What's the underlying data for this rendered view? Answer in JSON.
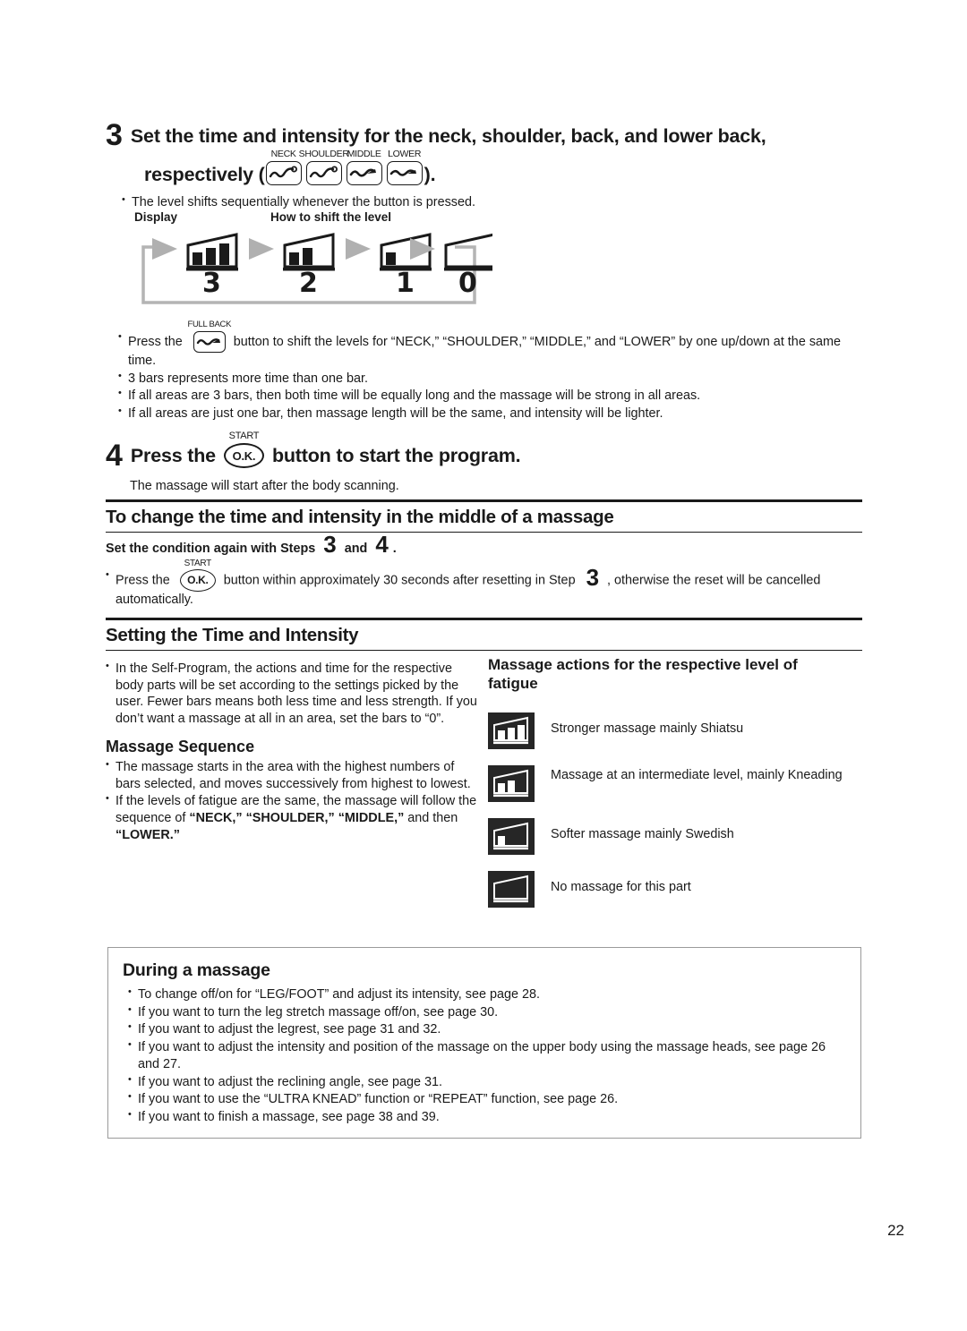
{
  "page": {
    "number": "22"
  },
  "step3": {
    "number": "3",
    "title_line1": "Set the time and intensity for the neck, shoulder, back, and lower back,",
    "title_line2_pre": "respectively (",
    "title_line2_post": ").",
    "buttons": [
      {
        "caption": "NECK",
        "icon": "massage-wave-icon"
      },
      {
        "caption": "SHOULDER",
        "icon": "massage-wave-icon"
      },
      {
        "caption": "MIDDLE",
        "icon": "massage-wave-icon"
      },
      {
        "caption": "LOWER",
        "icon": "massage-wave-icon"
      }
    ],
    "note": "The level shifts sequentially whenever the button is pressed."
  },
  "diagram": {
    "label_display": "Display",
    "label_howto": "How to shift the level",
    "levels": [
      {
        "value": "3",
        "bars": 3,
        "icon": "level-3-icon"
      },
      {
        "value": "2",
        "bars": 2,
        "icon": "level-2-icon"
      },
      {
        "value": "1",
        "bars": 1,
        "icon": "level-1-icon"
      },
      {
        "value": "0",
        "bars": 0,
        "icon": "level-0-icon"
      }
    ]
  },
  "fullback": {
    "caption": "FULL BACK",
    "bullets": [
      {
        "pre": "Press the",
        "post": "button to shift the levels for “NECK,” “SHOULDER,” “MIDDLE,” and “LOWER” by one up/down at the same time."
      }
    ],
    "plain_bullets": [
      "3 bars represents more time than one bar.",
      "If all areas are 3 bars, then both time will be equally long and the massage will be strong in all areas.",
      "If all areas are just one bar, then massage length will be the same, and intensity will be lighter."
    ]
  },
  "step4": {
    "number": "4",
    "title_pre": "Press the",
    "title_post": "button to start the program.",
    "button": {
      "caption": "START",
      "label": "O.K."
    },
    "note": "The massage will start after the body scanning."
  },
  "section_change": {
    "heading": "To change the time and intensity in the middle of a massage",
    "lead_pre": "Set the condition again with Steps",
    "lead_num1": "3",
    "lead_and": "and",
    "lead_num2": "4",
    "lead_end": ".",
    "bullet_pre": "Press the",
    "button": {
      "caption": "START",
      "label": "O.K."
    },
    "bullet_mid": "button within approximately 30 seconds after resetting in Step",
    "bullet_num": "3",
    "bullet_post": ", otherwise the reset will be cancelled automatically."
  },
  "section_setting": {
    "heading": "Setting the Time and Intensity",
    "left": {
      "intro": "In the Self-Program, the actions and time for the respective body parts will be set according to the settings picked by the user. Fewer bars means both less time and less strength.  If you don’t want a massage at all in an area, set the bars to “0”.",
      "subhead": "Massage Sequence",
      "bullets": [
        "The massage starts in the area with the highest numbers of bars selected, and moves successively from highest to lowest."
      ],
      "sequence_bullet": {
        "pre": "If the levels of fatigue are the same, the massage will follow the sequence of ",
        "b1": "“NECK,” “SHOULDER,” “MIDDLE,”",
        "mid": " and then ",
        "b2": "“LOWER.”"
      }
    },
    "right": {
      "subhead": "Massage actions for the respective level of fatigue",
      "items": [
        {
          "icon": "level-3-inverted-icon",
          "bars": 3,
          "text": "Stronger massage mainly Shiatsu"
        },
        {
          "icon": "level-2-inverted-icon",
          "bars": 2,
          "text": "Massage at an intermediate level, mainly Kneading"
        },
        {
          "icon": "level-1-inverted-icon",
          "bars": 1,
          "text": "Softer massage mainly Swedish"
        },
        {
          "icon": "level-0-inverted-icon",
          "bars": 0,
          "text": "No massage for this part"
        }
      ]
    }
  },
  "during_massage": {
    "heading": "During a massage",
    "bullets": [
      "To change off/on for “LEG/FOOT” and adjust its intensity, see page 28.",
      "If you want to turn the leg stretch massage off/on, see page 30.",
      "If you want to adjust the legrest, see page 31 and 32.",
      "If you want to adjust the intensity and position of the massage on the upper body using the massage heads, see page 26 and 27.",
      "If you want to adjust the reclining angle, see page 31.",
      "If you want to use the “ULTRA KNEAD” function or “REPEAT” function, see page 26.",
      "If you want to finish a massage, see page 38 and 39."
    ]
  },
  "colors": {
    "ink": "#1a1a1a",
    "arrow_gray": "#9e9e9e",
    "icon_dark": "#262626",
    "box_border": "#9a9a9a"
  }
}
